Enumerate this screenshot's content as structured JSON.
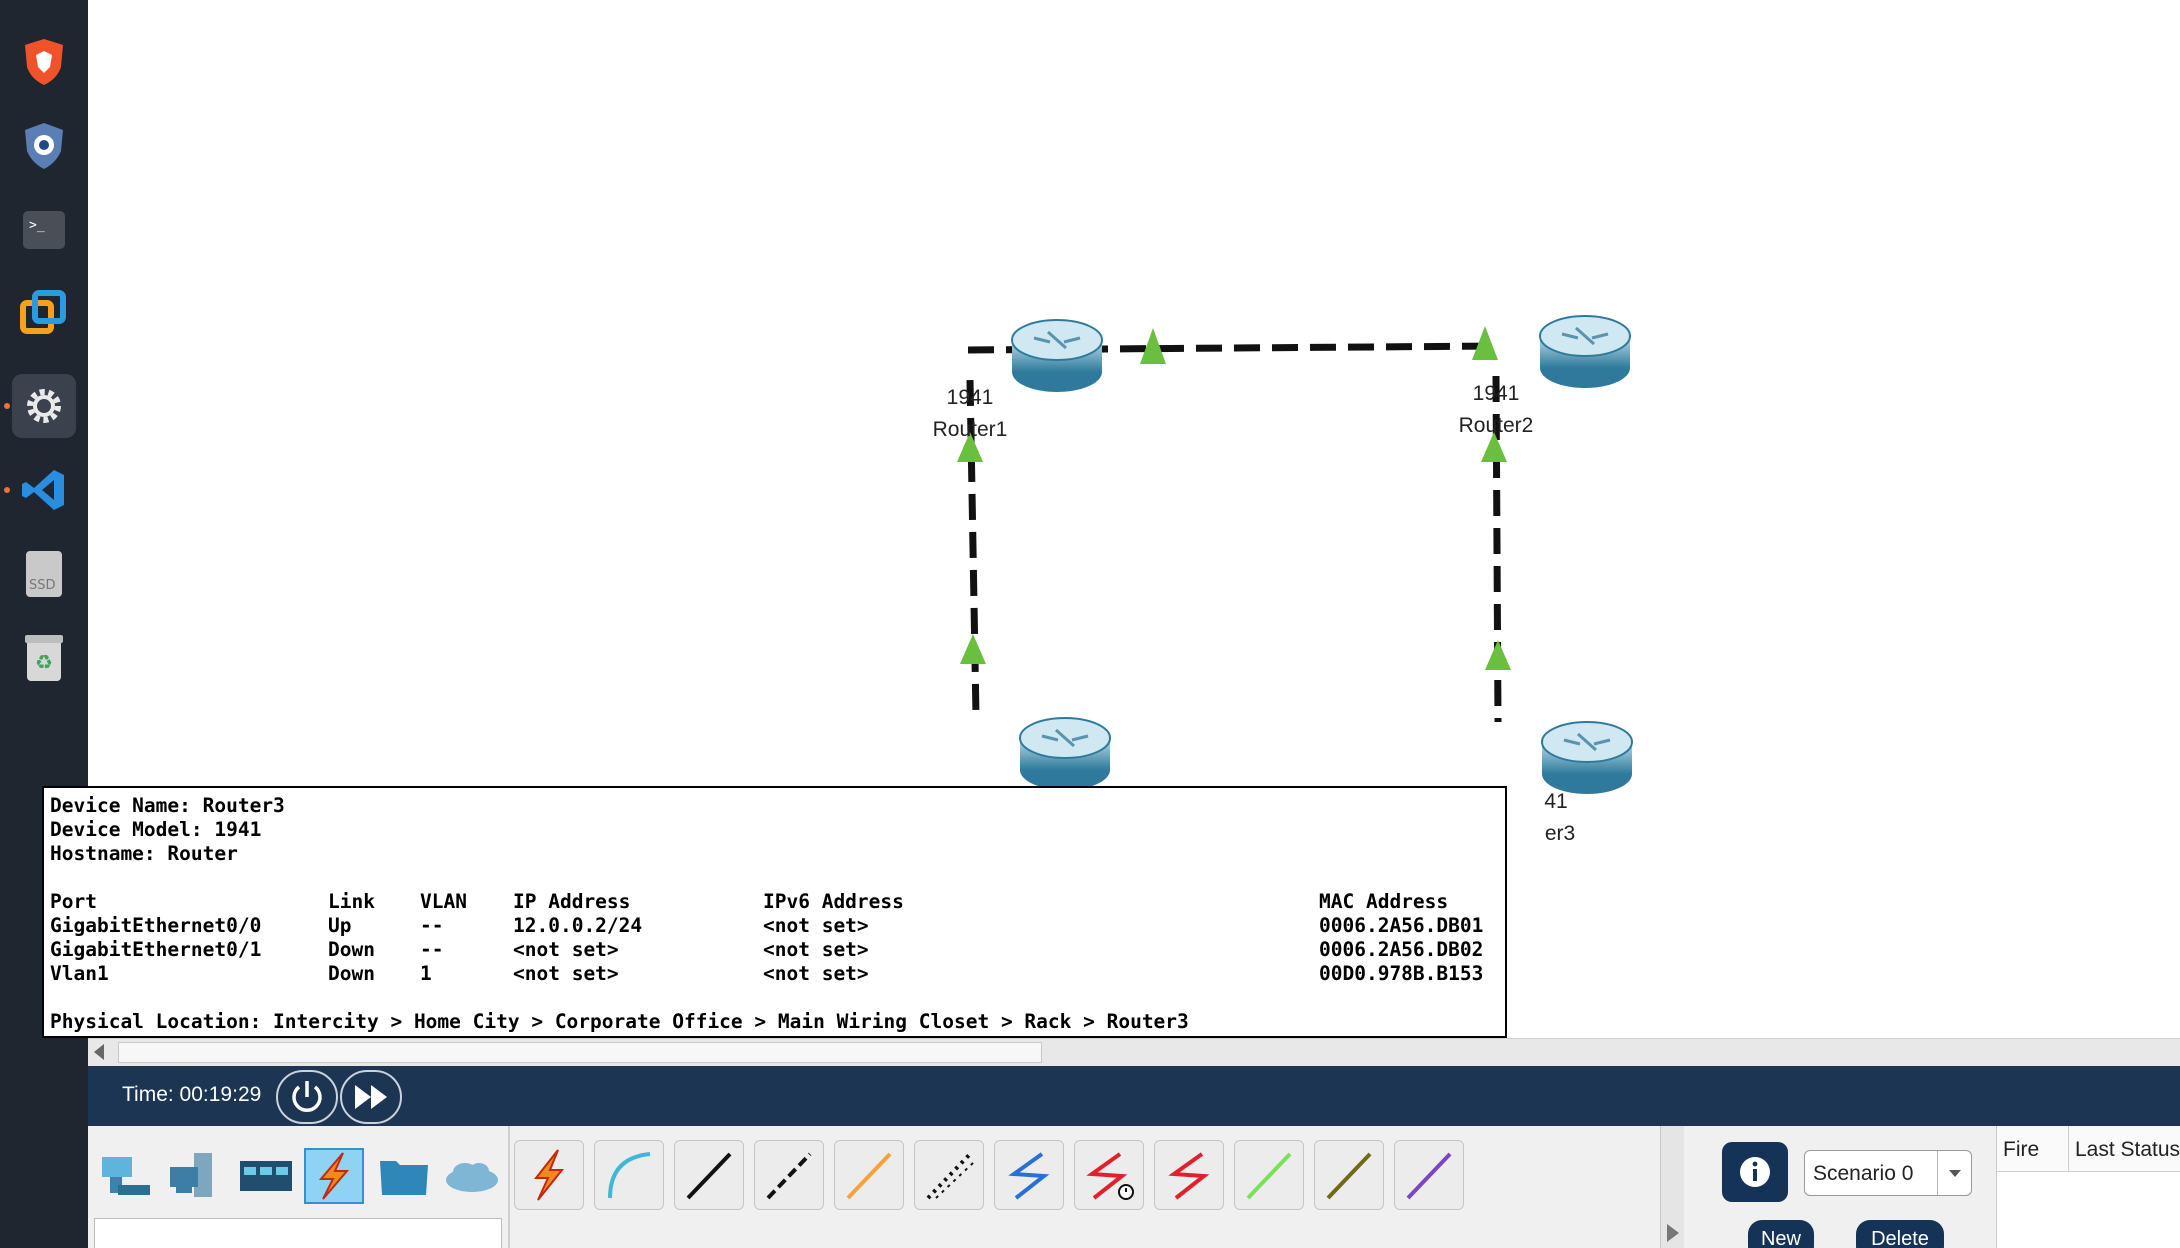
{
  "dock": {
    "items": [
      {
        "name": "brave-browser",
        "icon": "lion-shield-icon"
      },
      {
        "name": "vpn-shield",
        "icon": "shield-lock-icon"
      },
      {
        "name": "terminal",
        "icon": "terminal-icon"
      },
      {
        "name": "vmware",
        "icon": "vmware-icon"
      },
      {
        "name": "settings",
        "icon": "gear-icon"
      },
      {
        "name": "vscode",
        "icon": "vscode-icon"
      },
      {
        "name": "ssd-drive",
        "icon": "drive-icon",
        "label": "SSD"
      },
      {
        "name": "trash",
        "icon": "trash-icon"
      }
    ]
  },
  "topology": {
    "devices": [
      {
        "model": "1941",
        "name": "Router1"
      },
      {
        "model": "1941",
        "name": "Router2"
      },
      {
        "model": "",
        "name": ""
      },
      {
        "model": "41",
        "name": "er3"
      }
    ]
  },
  "tooltip": {
    "device_name": "Device Name: Router3",
    "device_model": "Device Model: 1941",
    "hostname": "Hostname: Router",
    "headers": {
      "port": "Port",
      "link": "Link",
      "vlan": "VLAN",
      "ip": "IP Address",
      "ipv6": "IPv6 Address",
      "mac": "MAC Address"
    },
    "rows": [
      {
        "port": "GigabitEthernet0/0",
        "link": "Up",
        "vlan": "--",
        "ip": "12.0.0.2/24",
        "ipv6": "<not set>",
        "mac": "0006.2A56.DB01"
      },
      {
        "port": "GigabitEthernet0/1",
        "link": "Down",
        "vlan": "--",
        "ip": "<not set>",
        "ipv6": "<not set>",
        "mac": "0006.2A56.DB02"
      },
      {
        "port": "Vlan1",
        "link": "Down",
        "vlan": "1",
        "ip": "<not set>",
        "ipv6": "<not set>",
        "mac": "00D0.978B.B153"
      }
    ],
    "location": "Physical Location: Intercity > Home City > Corporate Office > Main Wiring Closet > Rack > Router3"
  },
  "timebar": {
    "time": "Time: 00:19:29"
  },
  "scenario": {
    "selected": "Scenario 0"
  },
  "pdu": {
    "new_label": "New",
    "delete_label": "Delete"
  },
  "pdu_table": {
    "col_fire": "Fire",
    "col_last_status": "Last Status"
  },
  "colors": {
    "link_up": "#6abf3f",
    "timebar_bg": "#1b3553",
    "accent_blue": "#143357"
  }
}
